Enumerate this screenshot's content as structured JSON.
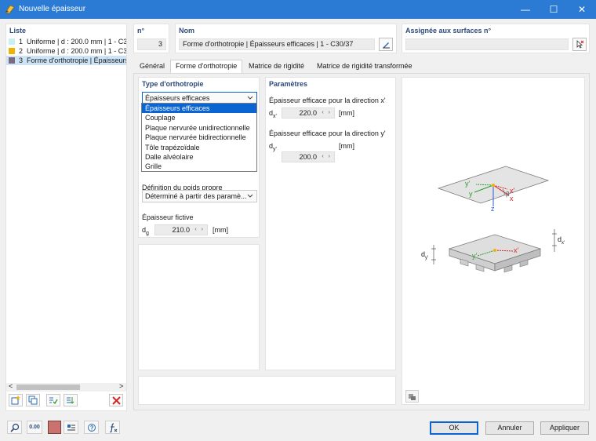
{
  "window": {
    "title": "Nouvelle épaisseur",
    "minimize": "—",
    "maximize": "☐",
    "close": "✕"
  },
  "list": {
    "header": "Liste",
    "items": [
      {
        "num": "1",
        "label": "Uniforme | d : 200.0 mm | 1 - C30/37",
        "color": "#c8f0f0"
      },
      {
        "num": "2",
        "label": "Uniforme | d : 200.0 mm | 1 - C30/37",
        "color": "#f0b400"
      },
      {
        "num": "3",
        "label": "Forme d'orthotropie | Épaisseurs efficaces",
        "color": "#7a6a82"
      }
    ],
    "scroll_left": "<",
    "scroll_right": ">"
  },
  "number": {
    "header": "n°",
    "value": "3"
  },
  "name": {
    "header": "Nom",
    "value": "Forme d'orthotropie | Épaisseurs efficaces | 1 - C30/37"
  },
  "assigned": {
    "header": "Assignée aux surfaces n°",
    "value": ""
  },
  "tabs": [
    "Général",
    "Forme d'orthotropie",
    "Matrice de rigidité",
    "Matrice de rigidité transformée"
  ],
  "ortho": {
    "type_header": "Type d'orthotropie",
    "type_value": "Épaisseurs efficaces",
    "options": [
      "Épaisseurs efficaces",
      "Couplage",
      "Plaque nervurée unidirectionnelle",
      "Plaque nervurée bidirectionnelle",
      "Tôle trapézoïdale",
      "Dalle alvéolaire",
      "Grille"
    ],
    "weight_label": "Définition du poids propre",
    "weight_value": "Déterminé à partir des paramè...",
    "fictive_label": "Épaisseur fictive",
    "fictive_sym": "d",
    "fictive_sub": "g",
    "fictive_value": "210.0",
    "fictive_unit": "[mm]"
  },
  "params": {
    "header": "Paramètres",
    "x_label": "Épaisseur efficace pour la direction x'",
    "x_sym": "d",
    "x_sub": "x'",
    "x_value": "220.0",
    "x_unit": "[mm]",
    "y_label": "Épaisseur efficace pour la direction y'",
    "y_sym": "d",
    "y_sub": "y'",
    "y_value": "200.0",
    "y_unit": "[mm]"
  },
  "diagram": {
    "top": {
      "y_prime": "y'",
      "x_prime": "x'",
      "y": "y",
      "x": "x",
      "z": "z",
      "beta": "β"
    },
    "bottom": {
      "y_prime": "y'",
      "x_prime": "x'",
      "dy": "d",
      "dy_sub": "y'",
      "dx": "d",
      "dx_sub": "x'"
    }
  },
  "buttons": {
    "ok": "OK",
    "cancel": "Annuler",
    "apply": "Appliquer"
  },
  "footer": {
    "zero": "0.00"
  },
  "colors": {
    "accent": "#2b7bd4",
    "selection": "#0a64d2",
    "header": "#2c4a7a",
    "swatch": "#c8736e"
  }
}
